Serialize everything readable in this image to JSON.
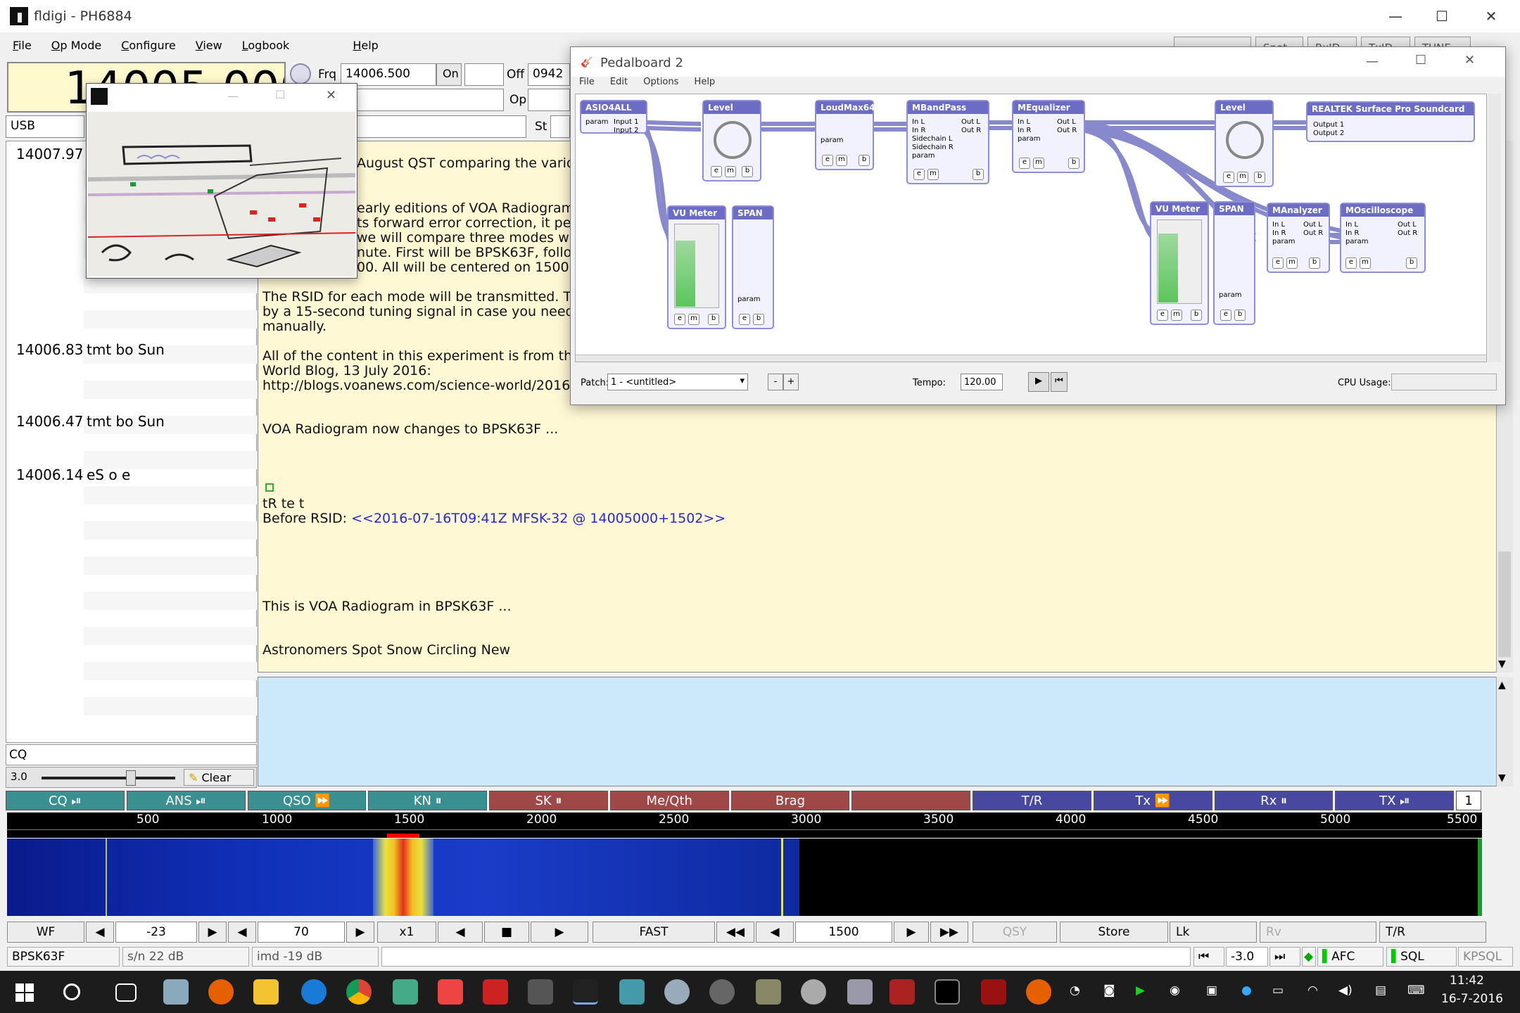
{
  "window": {
    "title": "fldigi - PH6884",
    "min": "—",
    "max": "☐",
    "close": "✕"
  },
  "menu": {
    "file": "File",
    "opmode": "Op Mode",
    "configure": "Configure",
    "view": "View",
    "logbook": "Logbook",
    "help": "Help"
  },
  "topbuttons": {
    "spot": "Spot",
    "rxid": "RxID",
    "txid": "TxID",
    "tune": "TUNE"
  },
  "freq": {
    "display": "14005.000",
    "frq_label": "Frq",
    "frq_value": "14006.500",
    "on_label": "On",
    "off_label": "Off",
    "off_value": "0942",
    "op_label": "Op",
    "st_label": "St",
    "mode": "USB"
  },
  "left_list": {
    "rows": [
      {
        "freq": "14007.97",
        "text": ""
      },
      {
        "freq": "14006.83",
        "text": "tmt bo Sun"
      },
      {
        "freq": "14006.47",
        "text": "tmt bo Sun"
      },
      {
        "freq": "14006.14",
        "text": "eS o e"
      }
    ],
    "cq": "CQ",
    "squelch": "3.0",
    "clear": "Clear"
  },
  "rx_text": {
    "l1": "August QST comparing the various \"f",
    "l2": "early editions of VOA Radiogram, we t",
    "l3": "ts forward error correction, it perform",
    "l4": "we will compare three modes with s",
    "l5": "nute. First will be BPSK63F, followed",
    "l6": "00. All will be centered on 1500 Hz.",
    "l7": "The RSID for each mode will be transmitted. That wil",
    "l8": "by a 15-second tuning signal in case you need to cha",
    "l9": "manually.",
    "l10": "All of the content in this experiment is from the VOA",
    "l11": "World Blog, 13 July 2016:",
    "l12": "http://blogs.voanews.com/science-world/2016/07/13",
    "l13": "VOA Radiogram now changes to BPSK63F ...",
    "l14": "tR te  t",
    "l15a": "Before RSID: ",
    "l15b": "<<2016-07-16T09:41Z MFSK-32 @ 14005000+1502>>",
    "l16": "This is VOA Radiogram in BPSK63F ...",
    "l17": "Astronomers Spot Snow Circling New"
  },
  "macros": [
    {
      "label": "CQ ⏯",
      "color": "#3a9090"
    },
    {
      "label": "ANS ⏯",
      "color": "#3a9090"
    },
    {
      "label": "QSO ⏩",
      "color": "#3a9090"
    },
    {
      "label": "KN ⏸",
      "color": "#3a9090"
    },
    {
      "label": "SK ⏸",
      "color": "#a04848"
    },
    {
      "label": "Me/Qth",
      "color": "#a04848"
    },
    {
      "label": "Brag",
      "color": "#a04848"
    },
    {
      "label": "",
      "color": "#a04848"
    },
    {
      "label": "T/R",
      "color": "#4848a0"
    },
    {
      "label": "Tx ⏩",
      "color": "#4848a0"
    },
    {
      "label": "Rx ⏸",
      "color": "#4848a0"
    },
    {
      "label": "TX ⏯",
      "color": "#4848a0"
    }
  ],
  "macro_page": "1",
  "ruler_ticks": [
    "500",
    "1000",
    "1500",
    "2000",
    "2500",
    "3000",
    "3500",
    "4000",
    "4500",
    "5000",
    "5500"
  ],
  "controls": {
    "wf": "WF",
    "ref": "-23",
    "range": "70",
    "x1": "x1",
    "fast": "FAST",
    "carrier": "1500",
    "qsy": "QSY",
    "store": "Store",
    "lk": "Lk",
    "rv": "Rv",
    "tr": "T/R"
  },
  "status": {
    "mode": "BPSK63F",
    "sn": "s/n 22 dB",
    "imd": "imd -19 dB",
    "afc_val": "-3.0",
    "afc": "AFC",
    "sql": "SQL",
    "kpsql": "KPSQL"
  },
  "pedalboard": {
    "title": "Pedalboard 2",
    "menu": [
      "File",
      "Edit",
      "Options",
      "Help"
    ],
    "plugins": {
      "asio": "ASIO4ALL",
      "level1": "Level",
      "loudmax": "LoudMax64",
      "mbandpass": "MBandPass",
      "mequalizer": "MEqualizer",
      "level2": "Level",
      "realtek": "REALTEK Surface Pro Soundcard",
      "vu1": "VU Meter",
      "span1": "SPAN",
      "vu2": "VU Meter",
      "span2": "SPAN",
      "manalyzer": "MAnalyzer",
      "moscilloscope": "MOscilloscope"
    },
    "ports": {
      "param": "param",
      "input1": "Input 1",
      "input2": "Input 2",
      "inL": "In L",
      "inR": "In R",
      "outL": "Out L",
      "outR": "Out R",
      "scL": "Sidechain L",
      "scR": "Sidechain R",
      "out1": "Output 1",
      "out2": "Output 2"
    },
    "btns": {
      "e": "e",
      "m": "m",
      "b": "b"
    },
    "patch_label": "Patch:",
    "patch_value": "1 - <untitled>",
    "minus": "-",
    "plus": "+",
    "tempo_label": "Tempo:",
    "tempo_value": "120.00",
    "cpu_label": "CPU Usage:"
  },
  "clock": {
    "time": "11:42",
    "date": "16-7-2016"
  },
  "colors": {
    "rx_bg": "#fff8d5",
    "tx_bg": "#cce8fb",
    "freq_bg": "#fffacd"
  }
}
